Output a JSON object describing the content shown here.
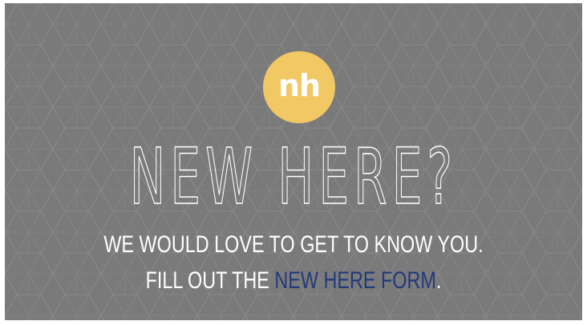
{
  "logo": {
    "text": "nh",
    "color": "#f2c865"
  },
  "headline": "NEW HERE?",
  "message": {
    "line1": "WE WOULD LOVE TO GET TO KNOW YOU.",
    "line2_prefix": "FILL OUT THE ",
    "line2_link": "NEW HERE FORM",
    "line2_suffix": "."
  },
  "colors": {
    "background": "#7a7a7a",
    "pattern_line": "#8c8c8c",
    "text": "#ffffff",
    "link": "#223a7a",
    "accent": "#f2c865"
  }
}
